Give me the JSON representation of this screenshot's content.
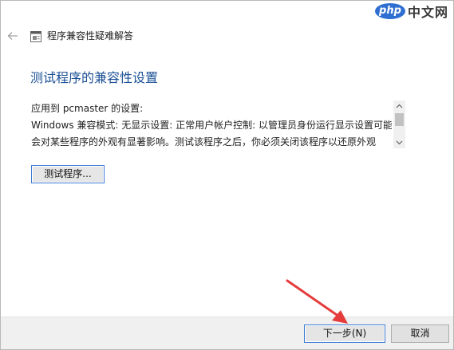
{
  "window": {
    "title": "程序兼容性疑难解答"
  },
  "watermark": {
    "logo": "php",
    "site": "中文网"
  },
  "main": {
    "heading": "测试程序的兼容性设置",
    "settings_lines": [
      "应用到 pcmaster 的设置:",
      "Windows 兼容模式: 无显示设置: 正常用户帐户控制: 以管理员身份运行显示设置可能",
      "会对某些程序的外观有显著影响。测试该程序之后，你必须关闭该程序以还原外观"
    ],
    "test_button_label": "测试程序..."
  },
  "footer": {
    "next_label": "下一步(N)",
    "cancel_label": "取消"
  },
  "colors": {
    "heading": "#1a4f95",
    "focus_border": "#3b79d4",
    "footer_bg": "#f0f0f0",
    "annotation_arrow": "#e53b3b"
  },
  "icons": {
    "back": "arrow-left-icon",
    "app": "troubleshooter-icon",
    "scroll_up": "chevron-up-icon",
    "scroll_down": "chevron-down-icon"
  }
}
